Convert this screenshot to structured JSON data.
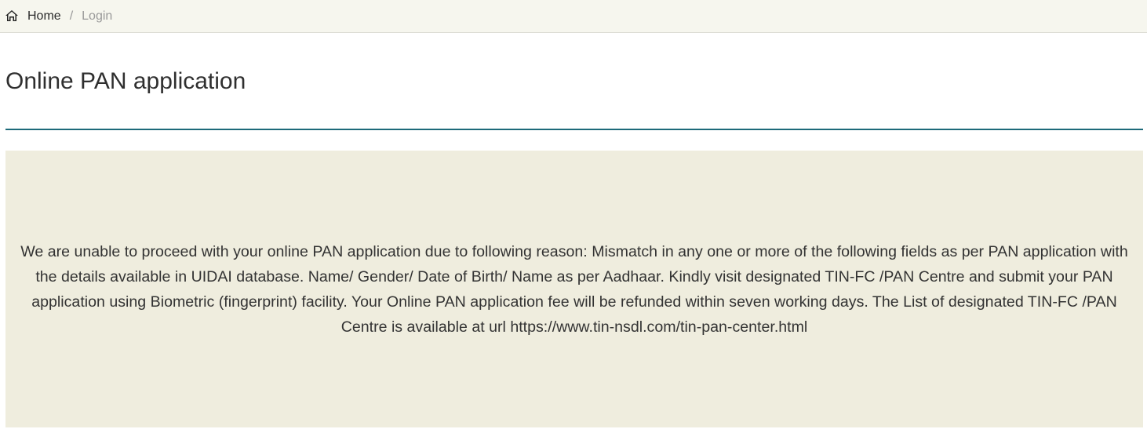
{
  "breadcrumb": {
    "home_icon": "home-icon",
    "home_label": "Home",
    "separator": "/",
    "current_label": "Login"
  },
  "page": {
    "title": "Online PAN application"
  },
  "message": {
    "text": "We are unable to proceed with your online PAN application due to following reason: Mismatch in any one or more of the following fields as per PAN application with the details available in UIDAI database. Name/ Gender/ Date of Birth/ Name as per Aadhaar. Kindly visit designated TIN-FC /PAN Centre and submit your PAN application using Biometric (fingerprint) facility. Your Online PAN application fee will be refunded within seven working days. The List of designated TIN-FC /PAN Centre is available at url https://www.tin-nsdl.com/tin-pan-center.html"
  },
  "colors": {
    "breadcrumb_bg": "#f6f6ee",
    "rule": "#1d6a7a",
    "panel_bg": "#efedde"
  }
}
